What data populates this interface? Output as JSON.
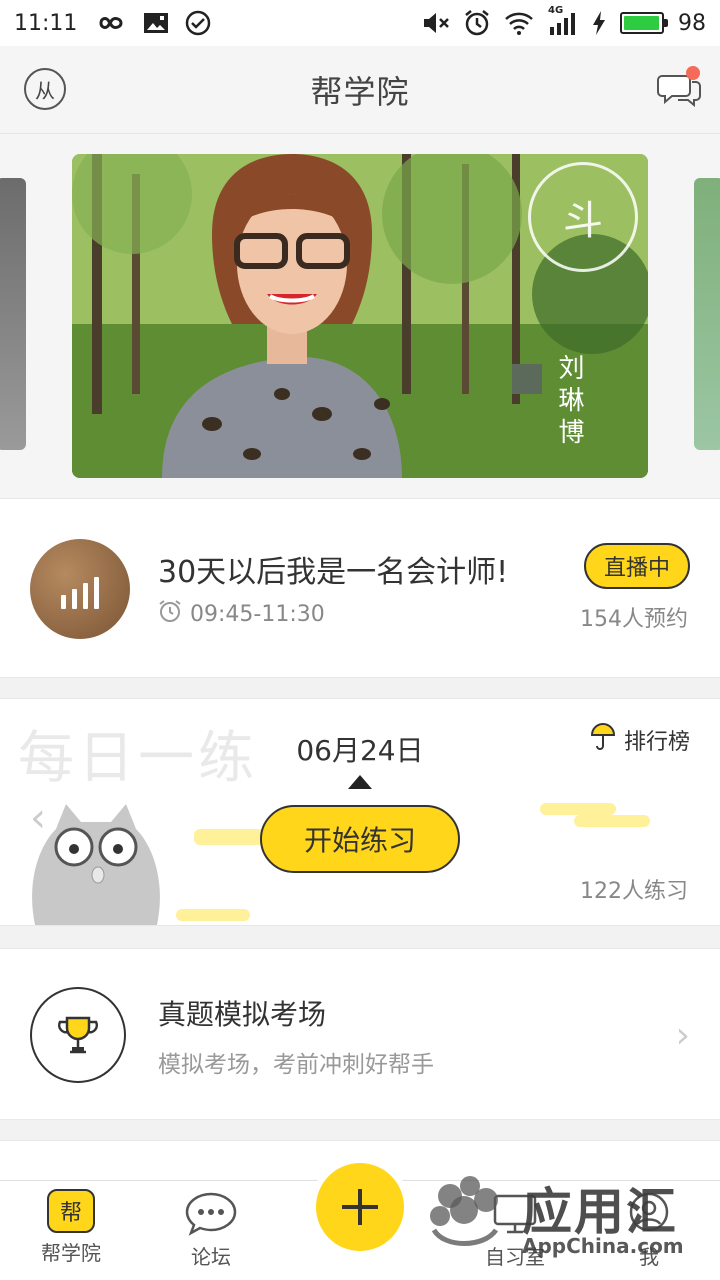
{
  "status_bar": {
    "time": "11:11",
    "battery_level": "98",
    "battery_fraction": 0.98,
    "icons": [
      "infinity-icon",
      "image-icon",
      "check-circle-icon",
      "mute-icon",
      "alarm-icon",
      "wifi-icon",
      "signal-4g-icon",
      "charging-icon",
      "battery-icon"
    ],
    "network_label": "4G"
  },
  "header": {
    "title": "帮学院",
    "logo_text": "从",
    "message_icon": "chat-bubbles-icon",
    "accent_dot_color": "#f46b5a"
  },
  "carousel": {
    "signature": "刘琳博",
    "stamp_text": "斗"
  },
  "live": {
    "title": "30天以后我是一名会计师!",
    "time": "09:45-11:30",
    "badge": "直播中",
    "count": "154人预约",
    "clock_icon": "alarm-clock-icon"
  },
  "daily": {
    "bg_title": "每日一练",
    "date": "06月24日",
    "rank_label": "排行榜",
    "rank_icon": "umbrella-icon",
    "start_label": "开始练习",
    "count": "122人练习",
    "prev_icon": "chevron-left-icon"
  },
  "exam": {
    "title": "真题模拟考场",
    "subtitle": "模拟考场，考前冲刺好帮手",
    "icon": "trophy-icon"
  },
  "nav": {
    "home_icon_text": "帮",
    "home_label": "帮学院",
    "forum_label": "论坛",
    "study_label": "自习室",
    "me_label": "我",
    "fab_icon": "plus-icon"
  },
  "watermark": {
    "brand": "应用汇",
    "url": "AppChina.com"
  },
  "colors": {
    "accent": "#ffd61a",
    "battery": "#2ecc40",
    "text": "#333333",
    "muted": "#888888"
  }
}
